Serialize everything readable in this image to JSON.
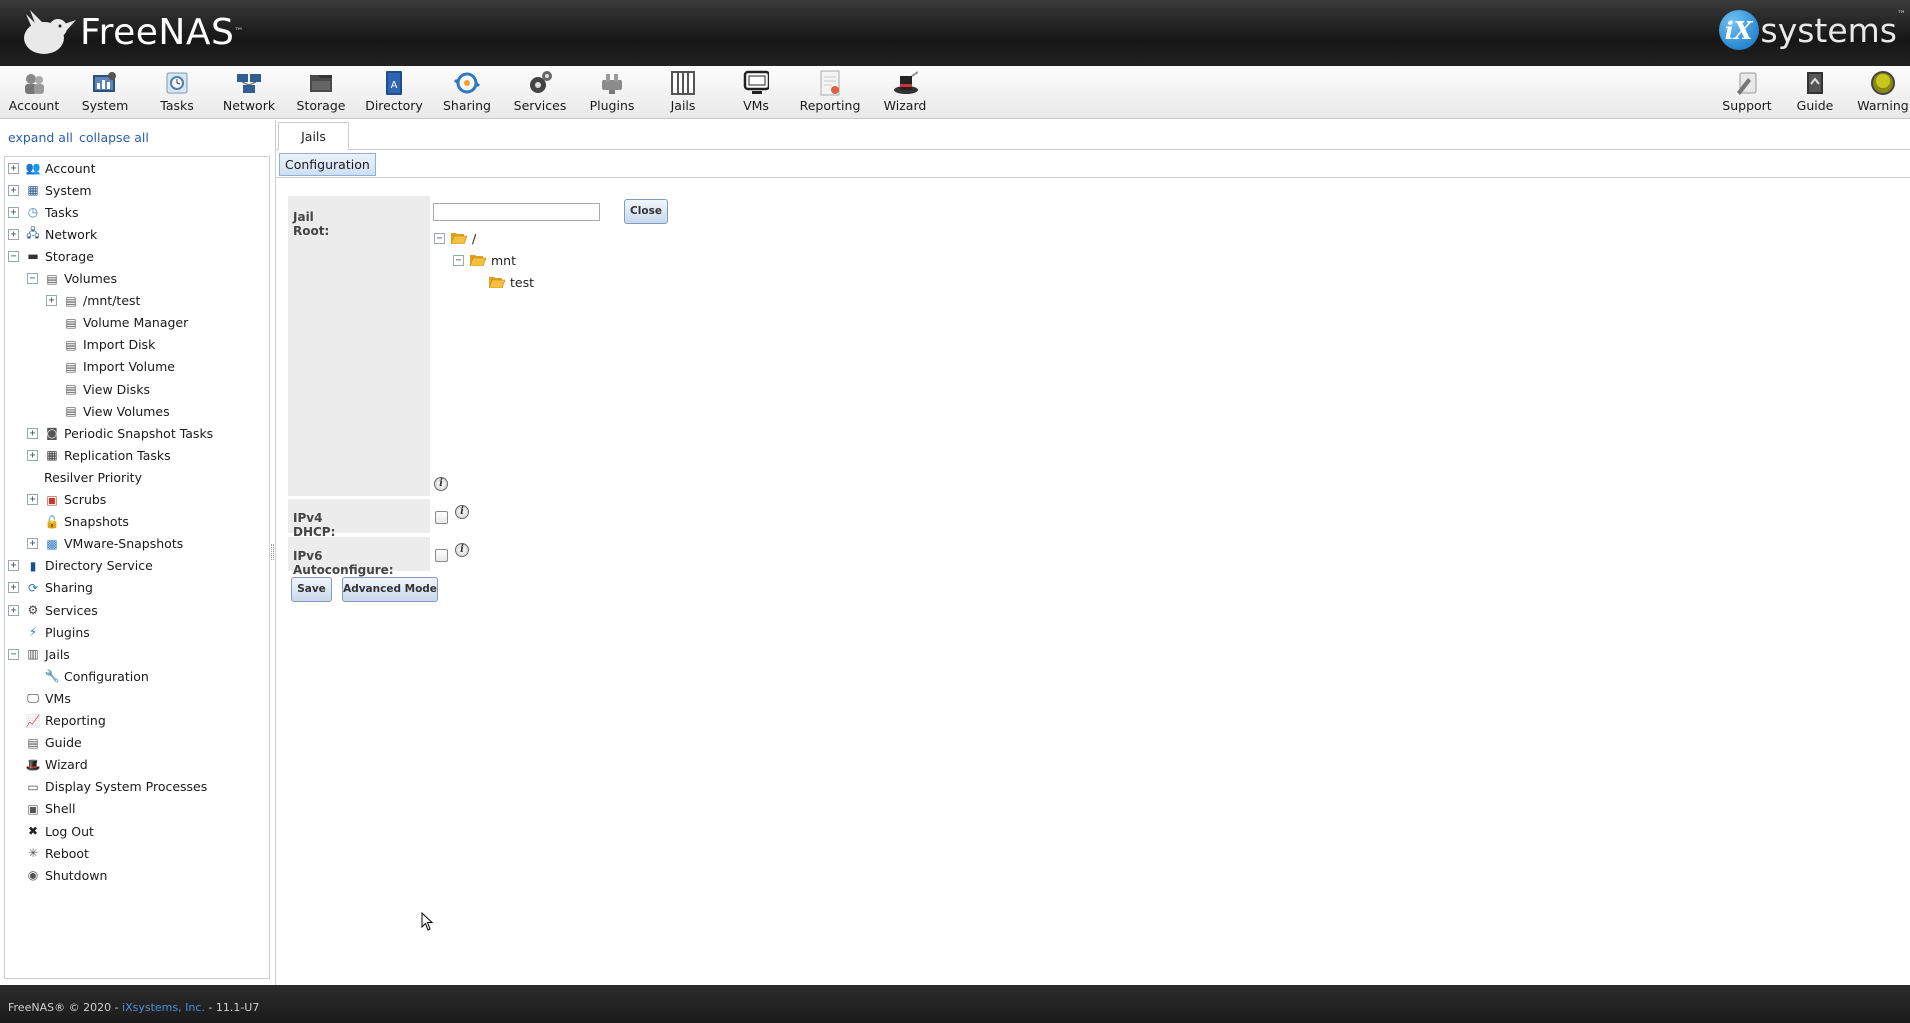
{
  "header": {
    "brand": "FreeNAS",
    "brand_tm": "™",
    "vendor_mark": "iX",
    "vendor_text": "systems",
    "vendor_tm": "™"
  },
  "toolbar": {
    "left": [
      {
        "label": "Account",
        "icon": "account-icon"
      },
      {
        "label": "System",
        "icon": "system-icon"
      },
      {
        "label": "Tasks",
        "icon": "tasks-icon"
      },
      {
        "label": "Network",
        "icon": "network-icon"
      },
      {
        "label": "Storage",
        "icon": "storage-icon"
      },
      {
        "label": "Directory",
        "icon": "directory-icon"
      },
      {
        "label": "Sharing",
        "icon": "sharing-icon"
      },
      {
        "label": "Services",
        "icon": "services-icon"
      },
      {
        "label": "Plugins",
        "icon": "plugins-icon"
      },
      {
        "label": "Jails",
        "icon": "jails-icon"
      },
      {
        "label": "VMs",
        "icon": "vms-icon"
      },
      {
        "label": "Reporting",
        "icon": "reporting-icon"
      },
      {
        "label": "Wizard",
        "icon": "wizard-icon"
      }
    ],
    "right": [
      {
        "label": "Support",
        "icon": "support-icon"
      },
      {
        "label": "Guide",
        "icon": "guide-icon"
      },
      {
        "label": "Warning",
        "icon": "warning-icon"
      }
    ]
  },
  "sidebar": {
    "expand_all": "expand all",
    "collapse_all": "collapse all",
    "tree": [
      {
        "label": "Account",
        "expander": "+",
        "icon": "account-icon"
      },
      {
        "label": "System",
        "expander": "+",
        "icon": "system-icon"
      },
      {
        "label": "Tasks",
        "expander": "+",
        "icon": "tasks-icon"
      },
      {
        "label": "Network",
        "expander": "+",
        "icon": "network-icon"
      },
      {
        "label": "Storage",
        "expander": "−",
        "icon": "storage-icon"
      },
      {
        "label": "Volumes",
        "expander": "−",
        "icon": "volumes-icon"
      },
      {
        "label": "/mnt/test",
        "expander": "+",
        "icon": "volume-icon"
      },
      {
        "label": "Volume Manager",
        "expander": "",
        "icon": "volume-manager-icon"
      },
      {
        "label": "Import Disk",
        "expander": "",
        "icon": "import-disk-icon"
      },
      {
        "label": "Import Volume",
        "expander": "",
        "icon": "import-volume-icon"
      },
      {
        "label": "View Disks",
        "expander": "",
        "icon": "view-disks-icon"
      },
      {
        "label": "View Volumes",
        "expander": "",
        "icon": "view-volumes-icon"
      },
      {
        "label": "Periodic Snapshot Tasks",
        "expander": "+",
        "icon": "snapshot-tasks-icon"
      },
      {
        "label": "Replication Tasks",
        "expander": "+",
        "icon": "replication-icon"
      },
      {
        "label": "Resilver Priority",
        "expander": "",
        "icon": ""
      },
      {
        "label": "Scrubs",
        "expander": "+",
        "icon": "scrubs-icon"
      },
      {
        "label": "Snapshots",
        "expander": "",
        "icon": "snapshots-icon"
      },
      {
        "label": "VMware-Snapshots",
        "expander": "+",
        "icon": "vmware-icon"
      },
      {
        "label": "Directory Service",
        "expander": "+",
        "icon": "directory-icon"
      },
      {
        "label": "Sharing",
        "expander": "+",
        "icon": "sharing-icon"
      },
      {
        "label": "Services",
        "expander": "+",
        "icon": "services-icon"
      },
      {
        "label": "Plugins",
        "expander": "",
        "icon": "plugins-icon"
      },
      {
        "label": "Jails",
        "expander": "−",
        "icon": "jails-icon"
      },
      {
        "label": "Configuration",
        "expander": "",
        "icon": "wrench-icon"
      },
      {
        "label": "VMs",
        "expander": "",
        "icon": "vms-icon"
      },
      {
        "label": "Reporting",
        "expander": "",
        "icon": "reporting-icon"
      },
      {
        "label": "Guide",
        "expander": "",
        "icon": "guide-icon"
      },
      {
        "label": "Wizard",
        "expander": "",
        "icon": "wizard-icon"
      },
      {
        "label": "Display System Processes",
        "expander": "",
        "icon": "processes-icon"
      },
      {
        "label": "Shell",
        "expander": "",
        "icon": "shell-icon"
      },
      {
        "label": "Log Out",
        "expander": "",
        "icon": "logout-icon"
      },
      {
        "label": "Reboot",
        "expander": "",
        "icon": "reboot-icon"
      },
      {
        "label": "Shutdown",
        "expander": "",
        "icon": "shutdown-icon"
      }
    ]
  },
  "main": {
    "tab": "Jails",
    "subtab": "Configuration",
    "form": {
      "jail_root_label": "Jail Root:",
      "jail_root_value": "",
      "close_label": "Close",
      "tree": [
        {
          "label": "/",
          "expander": "−"
        },
        {
          "label": "mnt",
          "expander": "−"
        },
        {
          "label": "test",
          "expander": ""
        }
      ],
      "ipv4_label": "IPv4 DHCP:",
      "ipv4_checked": false,
      "ipv6_label": "IPv6 Autoconfigure:",
      "ipv6_checked": false,
      "save_label": "Save",
      "advanced_label": "Advanced Mode",
      "info_glyph": "i"
    }
  },
  "footer": {
    "prefix": "FreeNAS® © 2020 - ",
    "company": "iXsystems, Inc.",
    "suffix": " - 11.1-U7"
  }
}
